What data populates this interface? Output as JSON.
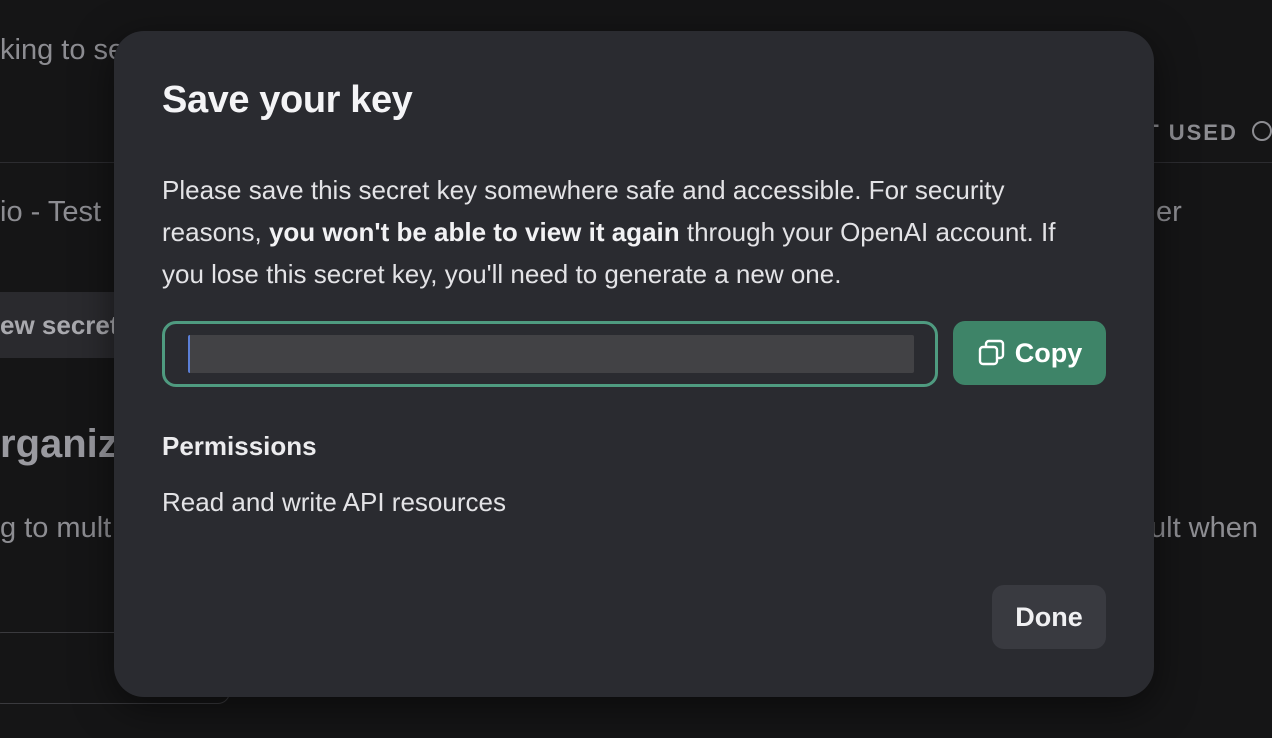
{
  "background": {
    "fragments": {
      "top_left": "king to se",
      "row_name": "io - Test",
      "row_right": "er",
      "pill_label": "ew secret",
      "section_heading": "rganiza",
      "section_text_left": "g to mult",
      "section_text_right": "ult when"
    },
    "column_header": "T USED"
  },
  "modal": {
    "title": "Save your key",
    "body": {
      "part1": "Please save this secret key somewhere safe and accessible. For security reasons, ",
      "bold": "you won't be able to view it again",
      "part2": " through your OpenAI account. If you lose this secret key, you'll need to generate a new one."
    },
    "key_field": {
      "value": ""
    },
    "copy_button": {
      "label": "Copy",
      "icon": "copy-icon",
      "color": "#3e8468"
    },
    "permissions": {
      "heading": "Permissions",
      "value": "Read and write API resources"
    },
    "done_button": {
      "label": "Done"
    },
    "accent_color": "#4f9b80"
  }
}
